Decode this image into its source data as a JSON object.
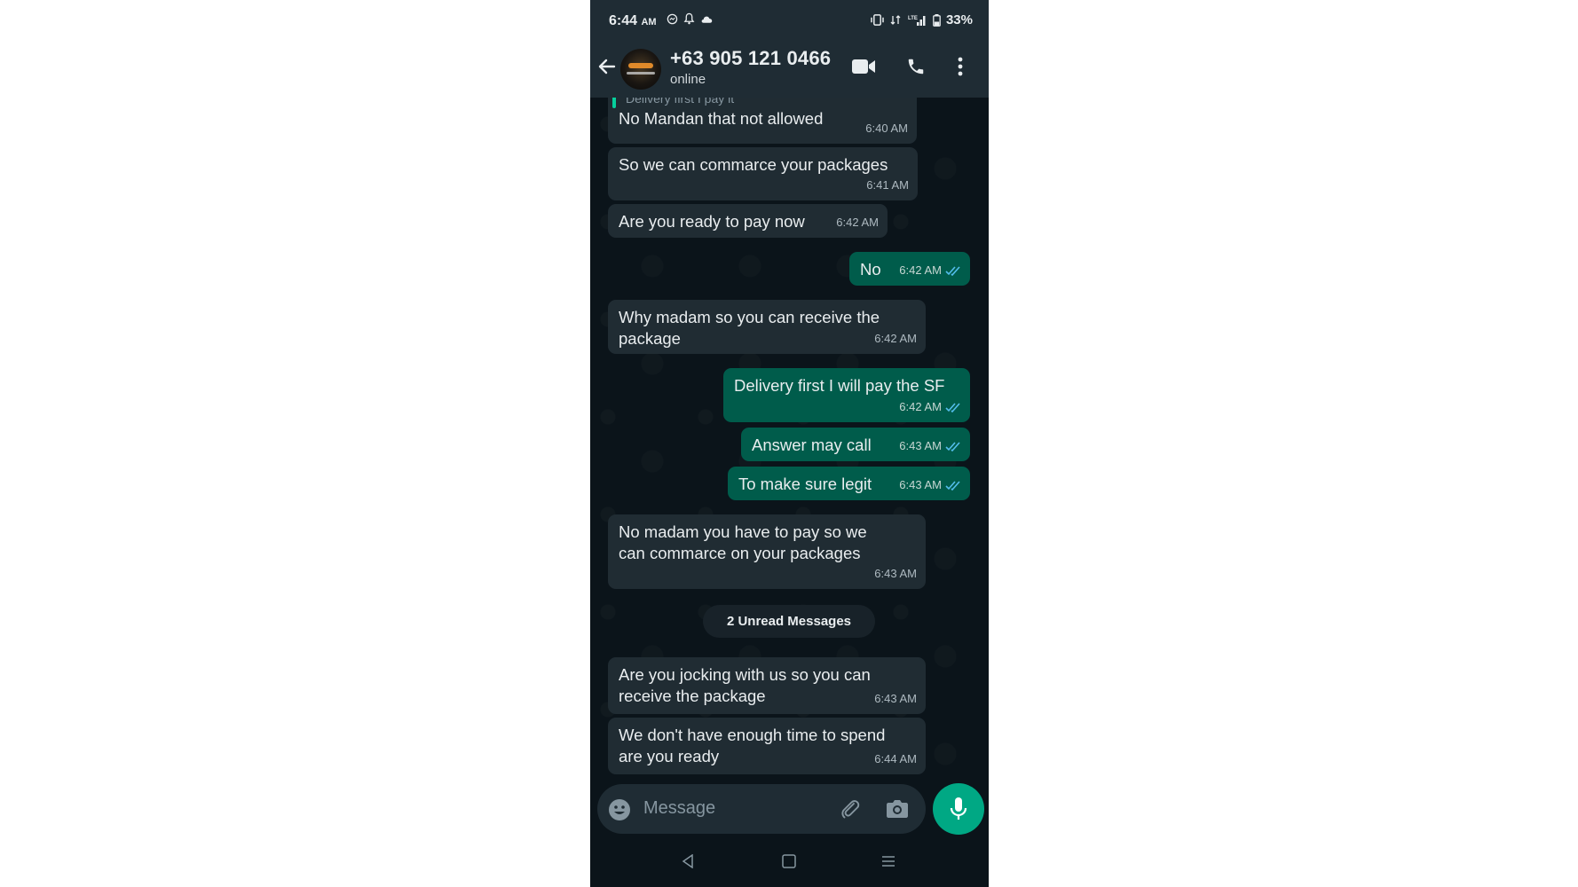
{
  "status_bar": {
    "time": "6:44",
    "ampm": "AM",
    "battery": "33%",
    "icons": [
      "messenger-icon",
      "bell-icon",
      "cloud-icon",
      "vibrate-icon",
      "data-icon",
      "lte-signal-icon",
      "battery-icon"
    ]
  },
  "header": {
    "contact_name": "+63 905 121 0466",
    "contact_status": "online",
    "icons": [
      "back-arrow-icon",
      "video-call-icon",
      "phone-call-icon",
      "more-vert-icon"
    ]
  },
  "chat": {
    "quoted_fragment": "Delivery first I pay it",
    "messages": [
      {
        "dir": "in",
        "text": "No Mandan that not allowed",
        "time": "6:40 AM"
      },
      {
        "dir": "in",
        "text": "So we can commarce your packages",
        "time": "6:41 AM"
      },
      {
        "dir": "in",
        "text": "Are you ready to pay now",
        "time": "6:42 AM"
      },
      {
        "dir": "out",
        "text": "No",
        "time": "6:42 AM",
        "read": true
      },
      {
        "dir": "in",
        "text": "Why madam so you can receive the package",
        "lines": [
          "Why madam so you can receive the",
          "package"
        ],
        "time": "6:42 AM"
      },
      {
        "dir": "out",
        "text": "Delivery first I will pay the SF",
        "time": "6:42 AM",
        "read": true
      },
      {
        "dir": "out",
        "text": "Answer may call",
        "time": "6:43 AM",
        "read": true
      },
      {
        "dir": "out",
        "text": "To make sure legit",
        "time": "6:43 AM",
        "read": true
      },
      {
        "dir": "in",
        "text": "No madam you have to pay so we can commarce on your packages",
        "lines": [
          "No madam you have to pay so we",
          "can commarce on your packages"
        ],
        "time": "6:43 AM"
      },
      {
        "dir": "in",
        "text": "Are you jocking with us so you can receive the package",
        "lines": [
          "Are you jocking with us so you can",
          "receive the package"
        ],
        "time": "6:43 AM"
      },
      {
        "dir": "in",
        "text": "We don't have enough time to spend are you ready",
        "lines": [
          "We don't have enough time to spend",
          "are you ready"
        ],
        "time": "6:44 AM"
      }
    ],
    "unread_divider": "2 Unread Messages"
  },
  "input": {
    "placeholder": "Message",
    "icons": [
      "emoji-icon",
      "attach-icon",
      "camera-icon",
      "mic-icon"
    ]
  },
  "nav": {
    "icons": [
      "nav-back-icon",
      "nav-home-icon",
      "nav-recents-icon"
    ]
  },
  "colors": {
    "bubble_in": "#202c33",
    "bubble_out": "#005c4b",
    "chat_bg": "#0b141a",
    "header_bg": "#1f2c34",
    "accent": "#00a884",
    "read_tick": "#53bdeb"
  }
}
